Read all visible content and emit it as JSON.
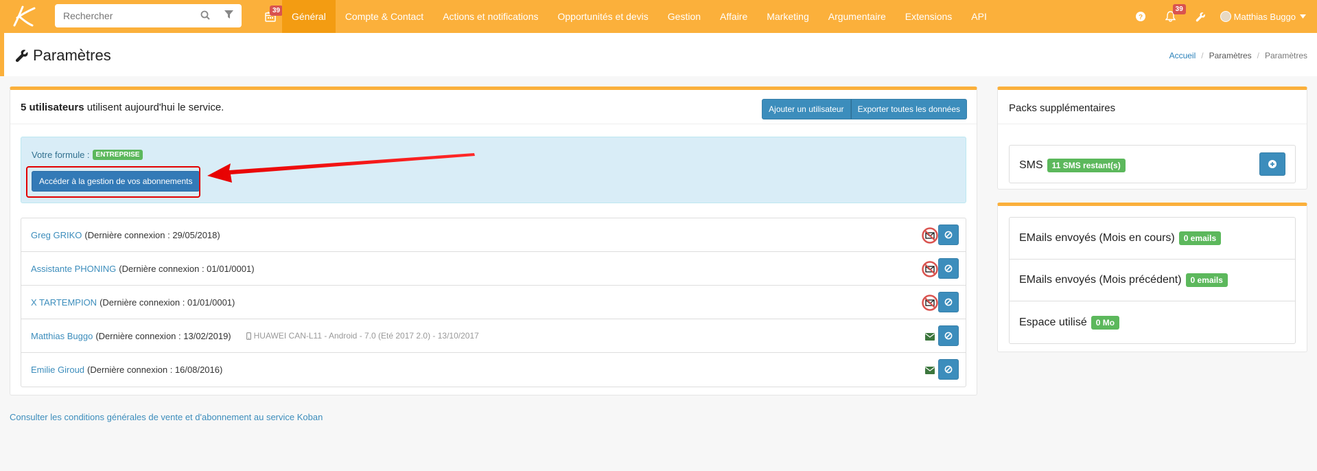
{
  "navbar": {
    "search_placeholder": "Rechercher",
    "calendar_badge": "39",
    "menu": [
      {
        "label": "Général",
        "active": true
      },
      {
        "label": "Compte & Contact"
      },
      {
        "label": "Actions et notifications"
      },
      {
        "label": "Opportunités et devis"
      },
      {
        "label": "Gestion"
      },
      {
        "label": "Affaire"
      },
      {
        "label": "Marketing"
      },
      {
        "label": "Argumentaire"
      },
      {
        "label": "Extensions"
      },
      {
        "label": "API"
      }
    ],
    "notifications_badge": "39",
    "user_name": "Matthias Buggo"
  },
  "page": {
    "title": "Paramètres",
    "breadcrumb": [
      "Accueil",
      "Paramètres",
      "Paramètres"
    ]
  },
  "main": {
    "summary_bold": "5 utilisateurs",
    "summary_rest": " utilisent aujourd'hui le service.",
    "add_user_label": "Ajouter un utilisateur",
    "export_label": "Exporter toutes les données",
    "formula_label": "Votre formule :",
    "formula_value": "ENTREPRISE",
    "access_label": "Accéder à la gestion de vos abonnements",
    "users": [
      {
        "name": "Greg GRIKO",
        "last": "(Dernière connexion : 29/05/2018)",
        "device": "",
        "mail": "disabled"
      },
      {
        "name": "Assistante PHONING",
        "last": "(Dernière connexion : 01/01/0001)",
        "device": "",
        "mail": "disabled"
      },
      {
        "name": "X TARTEMPION",
        "last": "(Dernière connexion : 01/01/0001)",
        "device": "",
        "mail": "disabled"
      },
      {
        "name": "Matthias Buggo",
        "last": "(Dernière connexion : 13/02/2019)",
        "device": "HUAWEI CAN-L11 - Android - 7.0 (Eté 2017 2.0) - 13/10/2017",
        "mail": "enabled"
      },
      {
        "name": "Emilie Giroud",
        "last": "(Dernière connexion : 16/08/2016)",
        "device": "",
        "mail": "enabled"
      }
    ],
    "cgv_link": "Consulter les conditions générales de vente et d'abonnement au service Koban"
  },
  "packs": {
    "title": "Packs supplémentaires",
    "sms_label": "SMS",
    "sms_badge": "11 SMS restant(s)"
  },
  "stats": {
    "rows": [
      {
        "label": "EMails envoyés (Mois en cours)",
        "badge": "0 emails"
      },
      {
        "label": "EMails envoyés (Mois précédent)",
        "badge": "0 emails"
      },
      {
        "label": "Espace utilisé",
        "badge": "0 Mo"
      }
    ]
  },
  "colors": {
    "brand": "#fbb03b",
    "primary": "#3c8dbc",
    "success": "#5cb85c",
    "danger": "#d9534f"
  }
}
